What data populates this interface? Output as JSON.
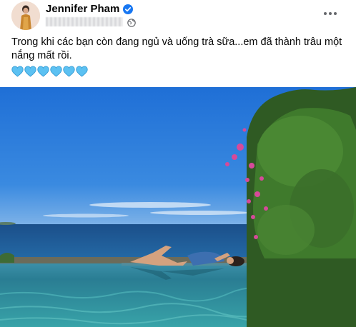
{
  "post": {
    "author_name": "Jennifer Pham",
    "caption": "Trong khi các bạn còn đang ngủ và uống trà sữa...em đã thành trâu một nắng mất rồi.",
    "hearts": [
      "blue-heart",
      "blue-heart",
      "blue-heart",
      "blue-heart",
      "blue-heart",
      "blue-heart"
    ],
    "colors": {
      "verified_badge": "#1877f2",
      "heart": "#5cc1f2",
      "sky": "#2e7fdc",
      "sea": "#1d4f86",
      "pool": "#2a8a95"
    }
  }
}
